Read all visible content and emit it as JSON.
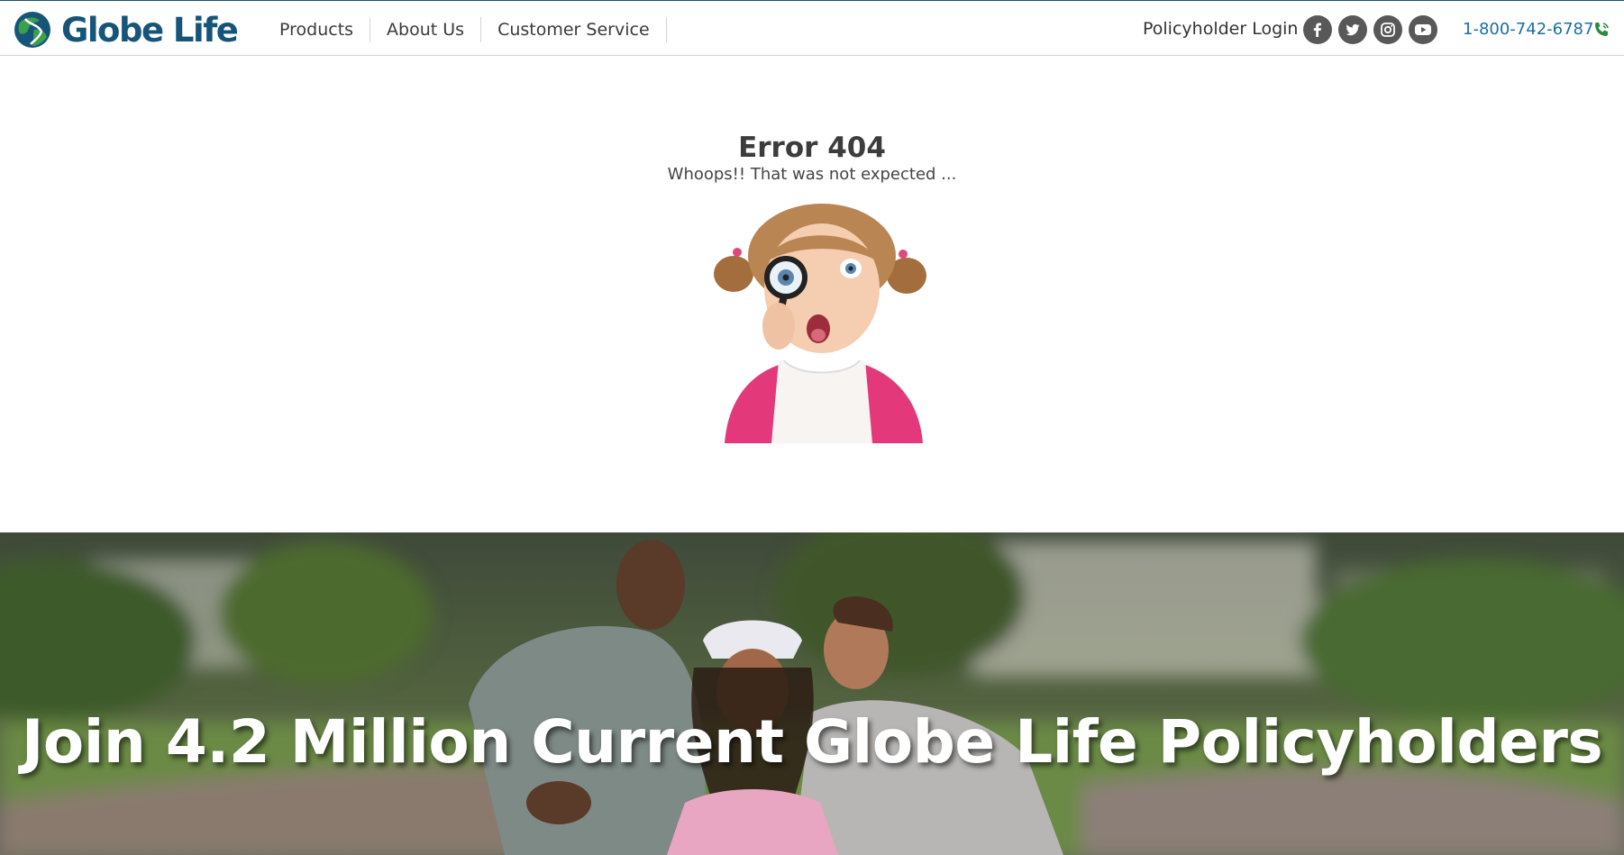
{
  "brand": {
    "name": "Globe Life",
    "color": "#16557a",
    "accent": "#2a8a3e"
  },
  "nav": {
    "items": [
      "Products",
      "About Us",
      "Customer Service"
    ]
  },
  "header": {
    "login_label": "Policyholder Login",
    "phone": "1-800-742-6787",
    "phone_color": "#1a6fa0",
    "socials": [
      "facebook-icon",
      "twitter-icon",
      "instagram-icon",
      "youtube-icon"
    ]
  },
  "error": {
    "title": "Error 404",
    "subtitle": "Whoops!! That was not expected ..."
  },
  "hero": {
    "title": "Join 4.2 Million Current Globe Life Policyholders"
  }
}
